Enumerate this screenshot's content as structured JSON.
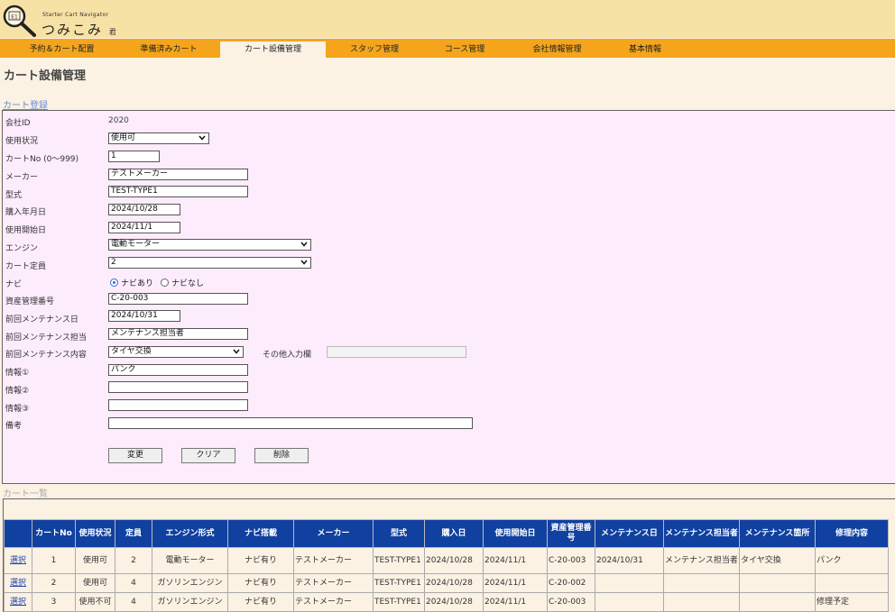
{
  "header": {
    "logo_icon_text": "E1",
    "logo_subtitle": "Starter Cart Navigator",
    "logo_title": "つみこみ",
    "logo_suffix": "君"
  },
  "nav": {
    "tabs": [
      {
        "label": "予約＆カート配置"
      },
      {
        "label": "準備済みカート"
      },
      {
        "label": "カート設備管理"
      },
      {
        "label": "スタッフ管理"
      },
      {
        "label": "コース管理"
      },
      {
        "label": "会社情報管理"
      },
      {
        "label": "基本情報"
      }
    ],
    "active_color": "#fbf2e4",
    "bar_color": "#f4a51c"
  },
  "page_title": "カート設備管理",
  "form": {
    "section_label": "カート登録",
    "company_id_label": "会社ID",
    "company_id_value": "2020",
    "status_label": "使用状況",
    "status_value": "使用可",
    "cart_no_label": "カートNo (0〜999)",
    "cart_no_value": "1",
    "maker_label": "メーカー",
    "maker_value": "テストメーカー",
    "model_label": "型式",
    "model_value": "TEST-TYPE1",
    "purchase_date_label": "購入年月日",
    "purchase_date_value": "2024/10/28",
    "start_date_label": "使用開始日",
    "start_date_value": "2024/11/1",
    "engine_label": "エンジン",
    "engine_value": "電動モーター",
    "capacity_label": "カート定員",
    "capacity_value": "2",
    "navi_label": "ナビ",
    "navi_on_label": "ナビあり",
    "navi_off_label": "ナビなし",
    "asset_no_label": "資産管理番号",
    "asset_no_value": "C-20-003",
    "last_maint_date_label": "前回メンテナンス日",
    "last_maint_date_value": "2024/10/31",
    "last_maint_person_label": "前回メンテナンス担当",
    "last_maint_person_value": "メンテナンス担当者",
    "last_maint_content_label": "前回メンテナンス内容",
    "last_maint_content_value": "タイヤ交換",
    "other_input_label": "その他入力欄",
    "other_input_value": "",
    "info1_label": "情報①",
    "info1_value": "パンク",
    "info2_label": "情報②",
    "info2_value": "",
    "info3_label": "情報③",
    "info3_value": "",
    "notes_label": "備考",
    "notes_value": "",
    "btn_change": "変更",
    "btn_clear": "クリア",
    "btn_delete": "削除"
  },
  "list": {
    "section_label": "カート一覧",
    "headers": [
      "",
      "カートNo",
      "使用状況",
      "定員",
      "エンジン形式",
      "ナビ搭載",
      "メーカー",
      "型式",
      "購入日",
      "使用開始日",
      "資産管理番号",
      "メンテナンス日",
      "メンテナンス担当者",
      "メンテナンス箇所",
      "修理内容"
    ],
    "rows": [
      [
        "選択",
        "1",
        "使用可",
        "2",
        "電動モーター",
        "ナビ有り",
        "テストメーカー",
        "TEST-TYPE1",
        "2024/10/28",
        "2024/11/1",
        "C-20-003",
        "2024/10/31",
        "メンテナンス担当者",
        "タイヤ交換",
        "パンク"
      ],
      [
        "選択",
        "2",
        "使用可",
        "4",
        "ガソリンエンジン",
        "ナビ有り",
        "テストメーカー",
        "TEST-TYPE1",
        "2024/10/28",
        "2024/11/1",
        "C-20-002",
        "",
        "",
        "",
        ""
      ],
      [
        "選択",
        "3",
        "使用不可",
        "4",
        "ガソリンエンジン",
        "ナビ有り",
        "テストメーカー",
        "TEST-TYPE1",
        "2024/10/28",
        "2024/11/1",
        "C-20-003",
        "",
        "",
        "",
        "修理予定"
      ]
    ],
    "header_color": "#1040a0"
  }
}
